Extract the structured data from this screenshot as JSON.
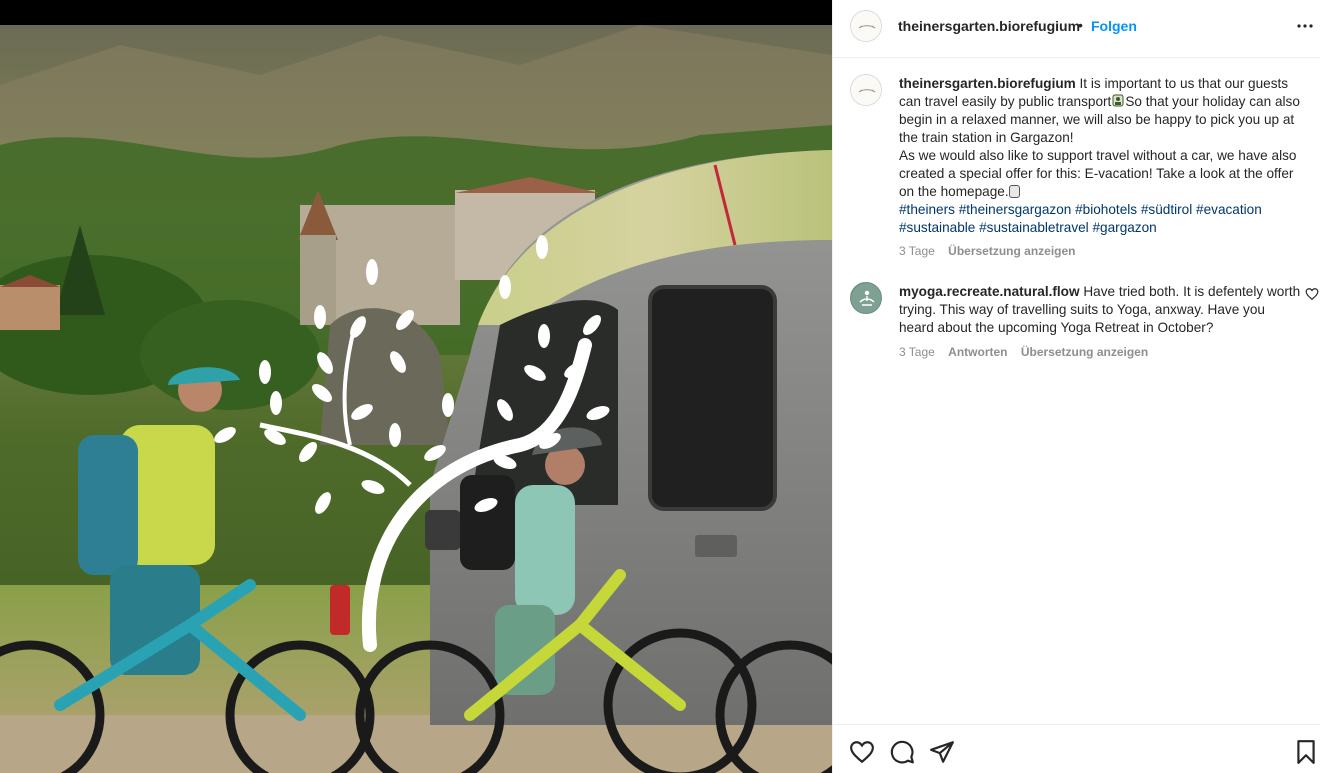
{
  "post": {
    "username": "theinersgarten.biorefugium",
    "follow_label": "Folgen",
    "separator": "•",
    "more_icon": "more-horizontal-icon"
  },
  "caption": {
    "username": "theinersgarten.biorefugium",
    "text_part1": "It is important to us that our guests can travel easily by public transport",
    "text_part2": "So that your holiday can also begin in a relaxed manner, we will also be happy to pick you up at the train station in Gargazon!",
    "text_part3": "As we would also like to support travel without a car, we have also created a special offer for this: E-vacation! Take a look at the offer on the homepage.",
    "hashtags": [
      "#theiners",
      "#theinersgargazon",
      "#biohotels",
      "#südtirol",
      "#evacation",
      "#sustainable",
      "#sustainabletravel",
      "#gargazon"
    ],
    "time": "3 Tage",
    "translate_label": "Übersetzung anzeigen"
  },
  "comment": {
    "username": "myoga.recreate.natural.flow",
    "text": "Have tried both. It is defentely worth trying. This way of travelling suits to Yoga, anxway. Have you heard about the upcoming Yoga Retreat in October?",
    "time": "3 Tage",
    "reply_label": "Antworten",
    "translate_label": "Übersetzung anzeigen"
  },
  "actions": {
    "like_icon": "heart-icon",
    "comment_icon": "comment-icon",
    "share_icon": "send-icon",
    "save_icon": "bookmark-icon"
  },
  "colors": {
    "link": "#0095f6",
    "hashtag": "#00376b",
    "meta": "#8e8e8e",
    "border": "#efefef"
  }
}
